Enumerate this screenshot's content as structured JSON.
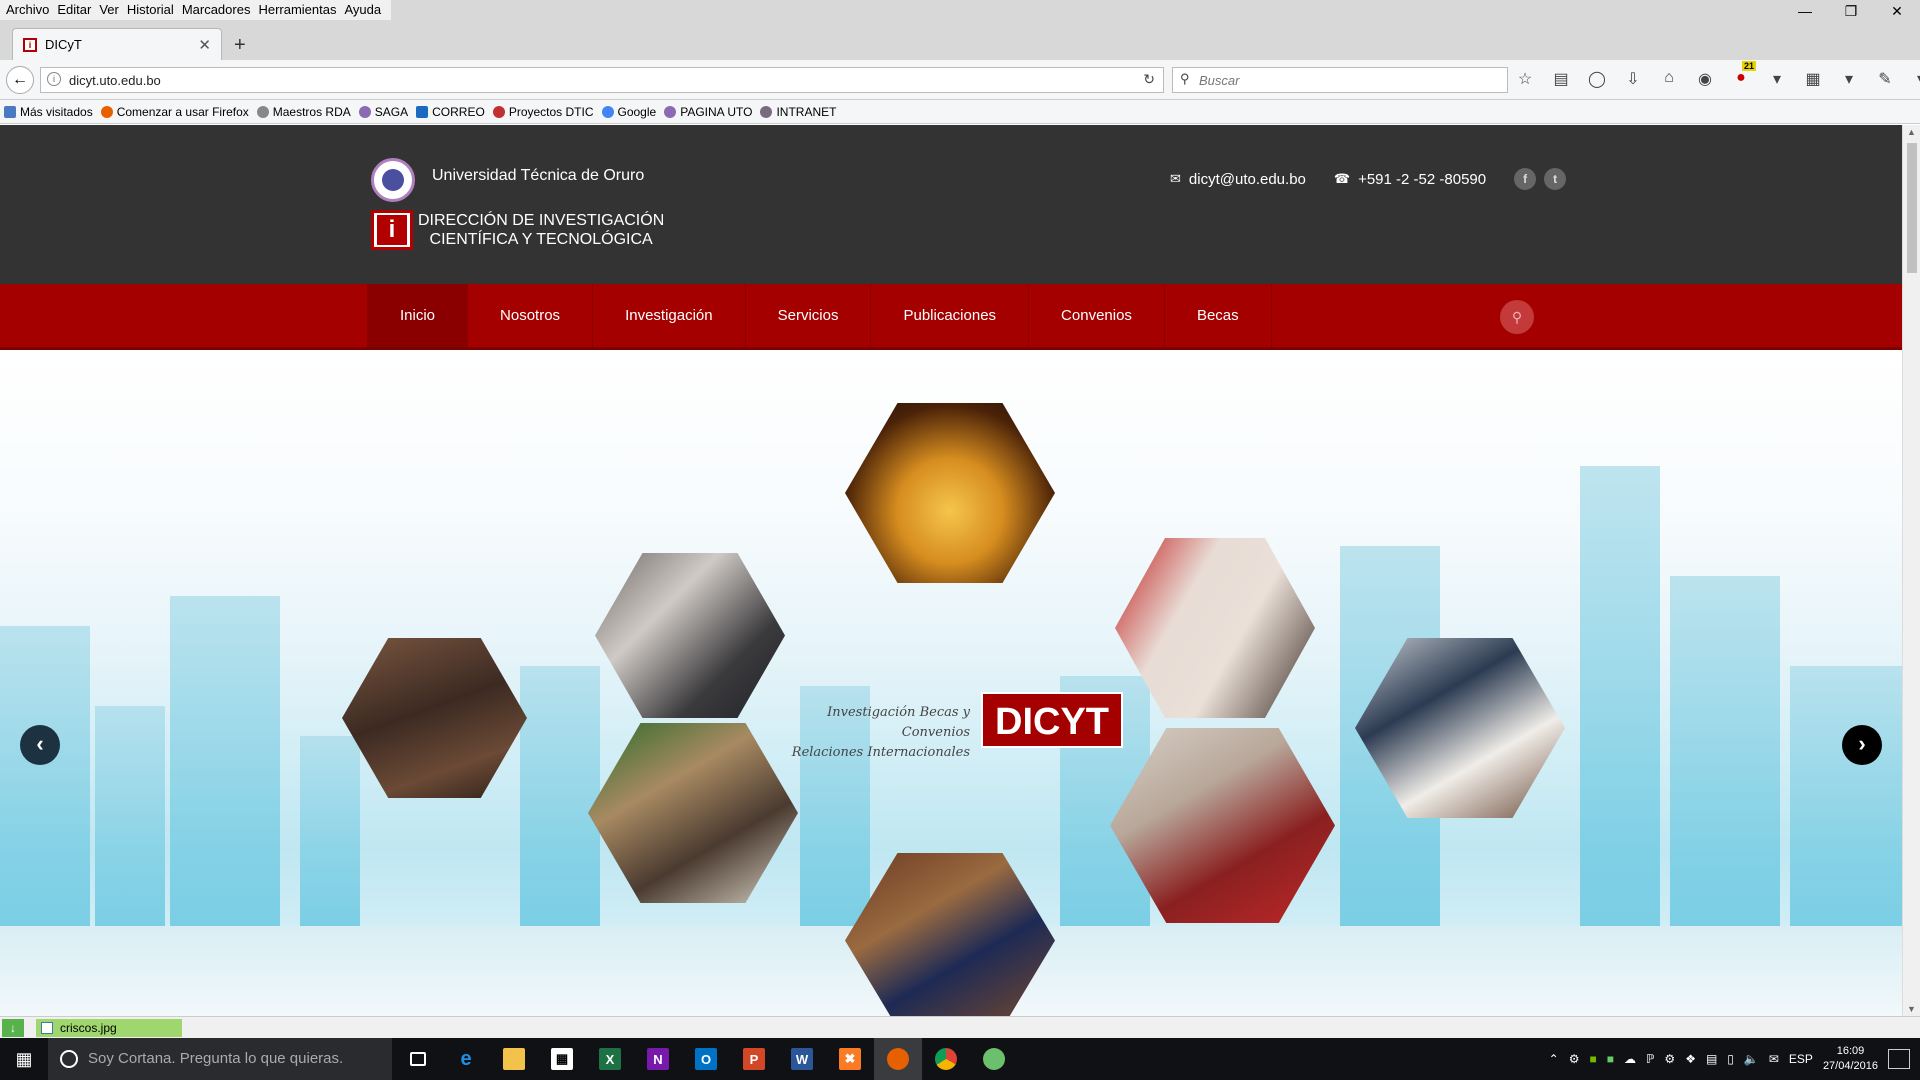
{
  "browser": {
    "menu": [
      "Archivo",
      "Editar",
      "Ver",
      "Historial",
      "Marcadores",
      "Herramientas",
      "Ayuda"
    ],
    "tab": {
      "title": "DICyT"
    },
    "url": "dicyt.uto.edu.bo",
    "search_placeholder": "Buscar",
    "badge_count": "21",
    "bookmarks": [
      "Más visitados",
      "Comenzar a usar Firefox",
      "Maestros RDA",
      "SAGA",
      "CORREO",
      "Proyectos DTIC",
      "Google",
      "PAGINA UTO",
      "INTRANET"
    ]
  },
  "site": {
    "university": "Universidad Técnica de Oruro",
    "dept_line1": "DIRECCIÓN DE INVESTIGACIÓN",
    "dept_line2": "CIENTÍFICA Y TECNOLÓGICA",
    "email": "dicyt@uto.edu.bo",
    "phone": "+591 -2 -52 -80590",
    "nav": [
      "Inicio",
      "Nosotros",
      "Investigación",
      "Servicios",
      "Publicaciones",
      "Convenios",
      "Becas"
    ],
    "active_nav": "Inicio"
  },
  "hero": {
    "tagline_line1": "Investigación  Becas y Convenios",
    "tagline_line2": "Relaciones Internacionales",
    "brand": "DICYT"
  },
  "download": {
    "filename": "criscos.jpg"
  },
  "taskbar": {
    "cortana_placeholder": "Soy Cortana. Pregunta lo que quieras.",
    "language": "ESP",
    "time": "16:09",
    "date": "27/04/2016"
  },
  "colors": {
    "brand_red": "#a50000",
    "header_dark": "#333333"
  }
}
